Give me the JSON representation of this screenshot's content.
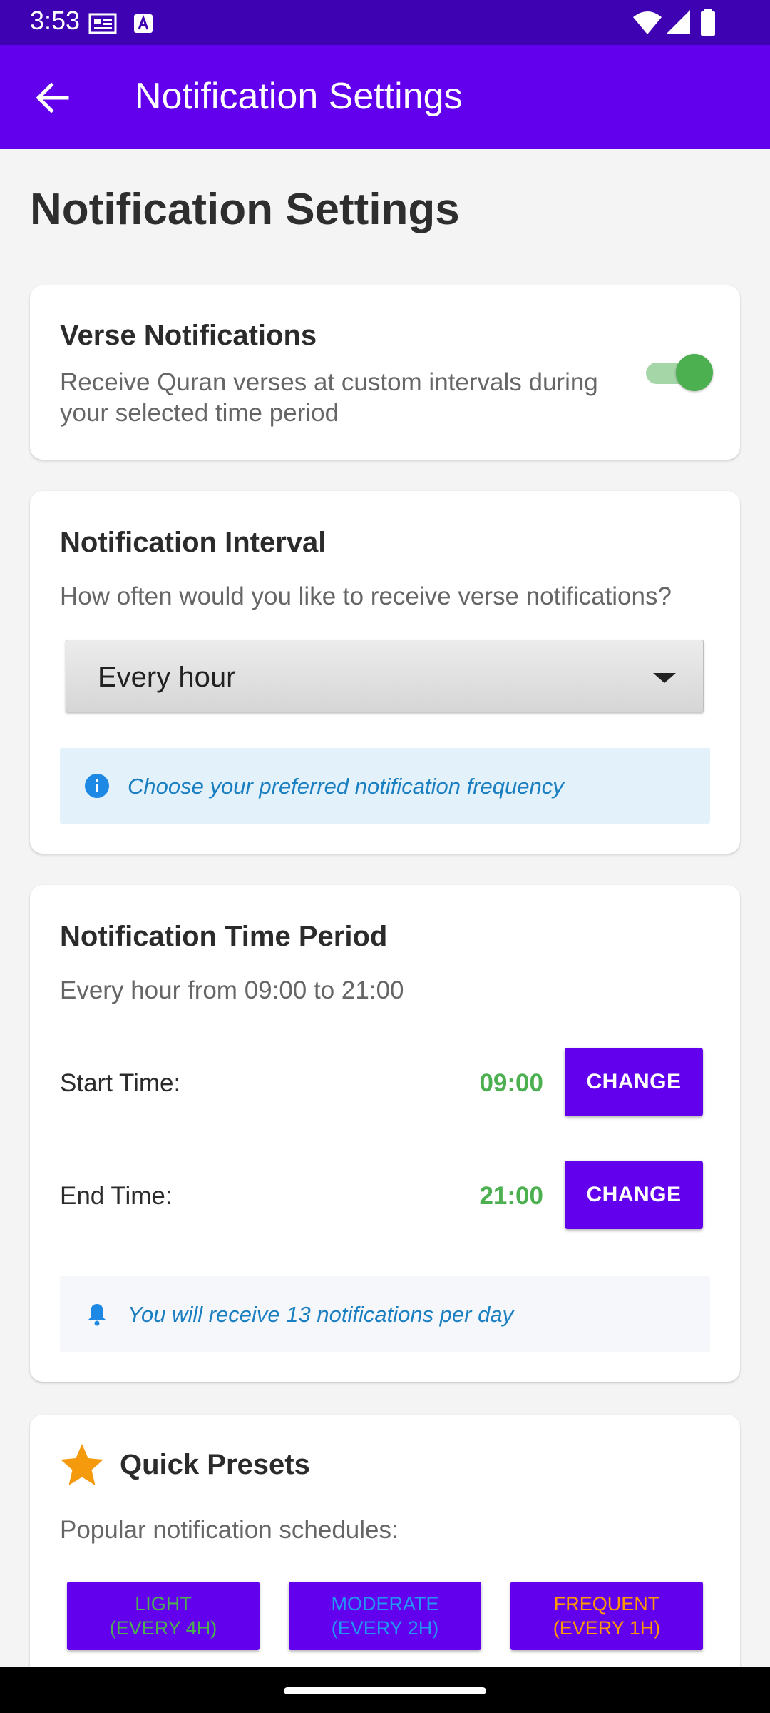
{
  "status_bar": {
    "time": "3:53"
  },
  "app_bar": {
    "title": "Notification Settings"
  },
  "page": {
    "title": "Notification Settings"
  },
  "verse_card": {
    "title": "Verse Notifications",
    "desc_line1": "Receive Quran verses at custom intervals during",
    "desc_line2": "your selected time period",
    "enabled": true
  },
  "interval_card": {
    "title": "Notification Interval",
    "desc": "How often would you like to receive verse notifications?",
    "selected": "Every hour",
    "info": "Choose your preferred notification frequency"
  },
  "time_card": {
    "title": "Notification Time Period",
    "summary": "Every hour from 09:00 to 21:00",
    "start_label": "Start Time:",
    "start_value": "09:00",
    "end_label": "End Time:",
    "end_value": "21:00",
    "change_label": "CHANGE",
    "info": "You will receive 13 notifications per day"
  },
  "presets_card": {
    "title": "Quick Presets",
    "desc": "Popular notification schedules:",
    "presets": [
      {
        "line1": "LIGHT",
        "line2": "(EVERY 4H)",
        "color": "#4caf50"
      },
      {
        "line1": "MODERATE",
        "line2": "(EVERY 2H)",
        "color": "#2196f3"
      },
      {
        "line1": "FREQUENT",
        "line2": "(EVERY 1H)",
        "color": "#ff9800"
      }
    ]
  },
  "colors": {
    "primary": "#6200ee",
    "status_bar": "#3e02b3",
    "accent_green": "#4caf50",
    "info_blue": "#1a7fc1"
  }
}
